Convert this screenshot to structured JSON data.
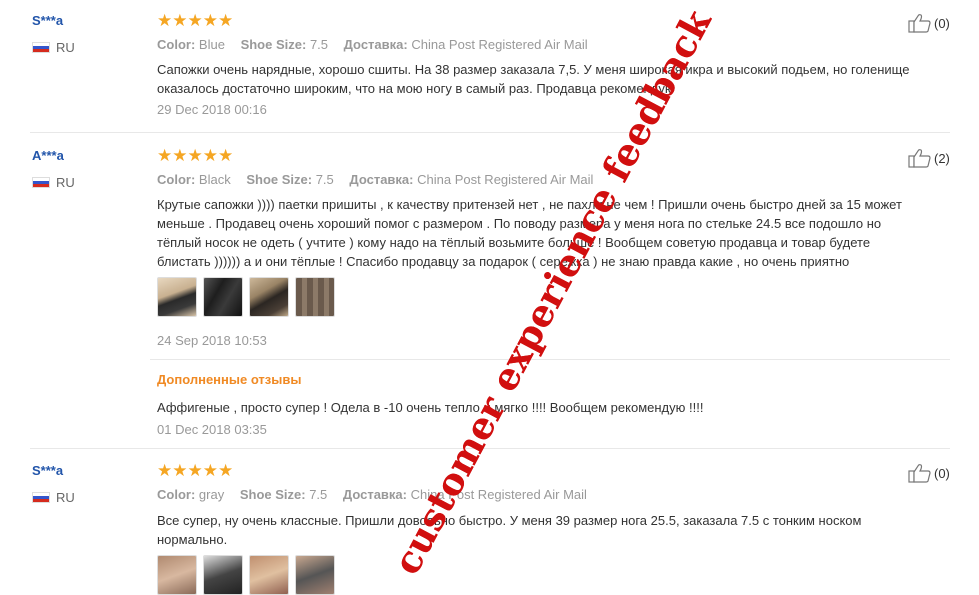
{
  "reviews": [
    {
      "user": "S***a",
      "country": "RU",
      "stars": "★★★★★",
      "color_label": "Color:",
      "color_value": "Blue",
      "size_label": "Shoe Size:",
      "size_value": "7.5",
      "delivery_label": "Доставка:",
      "delivery_value": "China Post Registered Air Mail",
      "text": "Сапожки очень нарядные, хорошо сшиты. На 38 размер заказала 7,5. У меня широкая икра и высокий подьем, но голенище оказалось достаточно широким, что на мою ногу в самый раз. Продавца рекомендую",
      "date": "29 Dec 2018 00:16",
      "helpful": "(0)"
    },
    {
      "user": "A***a",
      "country": "RU",
      "stars": "★★★★★",
      "color_label": "Color:",
      "color_value": "Black",
      "size_label": "Shoe Size:",
      "size_value": "7.5",
      "delivery_label": "Доставка:",
      "delivery_value": "China Post Registered Air Mail",
      "text": "Крутые сапожки )))) паетки пришиты , к качеству притензей нет , не пахли не чем ! Пришли очень быстро дней за 15 может меньше . Продавец очень хороший помог с размером . По поводу размера у меня нога по стельке 24.5 все подошло но тёплый носок не одеть ( учтите ) кому надо на тёплый возьмите больше ! Вообщем советую продавца и товар будете блистать )))))) а и они тёплые ! Спасибо продавцу за подарок ( сережка ) не знаю правда какие , но очень приятно",
      "date": "24 Sep 2018 10:53",
      "helpful": "(2)",
      "additional_title": "Дополненные отзывы",
      "additional_text": "Аффигеные , просто супер ! Одела в -10 очень тепло и мягко !!!! Вообщем рекомендую !!!!",
      "additional_date": "01 Dec 2018 03:35"
    },
    {
      "user": "S***a",
      "country": "RU",
      "stars": "★★★★★",
      "color_label": "Color:",
      "color_value": "gray",
      "size_label": "Shoe Size:",
      "size_value": "7.5",
      "delivery_label": "Доставка:",
      "delivery_value": "China Post Registered Air Mail",
      "text": "Все супер, ну очень классные. Пришли довольно быстро. У меня 39 размер нога 25.5, заказала 7.5 с тонким носком нормально.",
      "helpful": "(0)"
    }
  ],
  "watermark": "customer experience feedback",
  "colors": {
    "stars": "#f5a623",
    "username": "#2255aa",
    "additional": "#f08a24",
    "watermark": "#d10f0f"
  },
  "icons": {
    "like": "thumbs-up-icon",
    "flag": "ru-flag-icon"
  }
}
